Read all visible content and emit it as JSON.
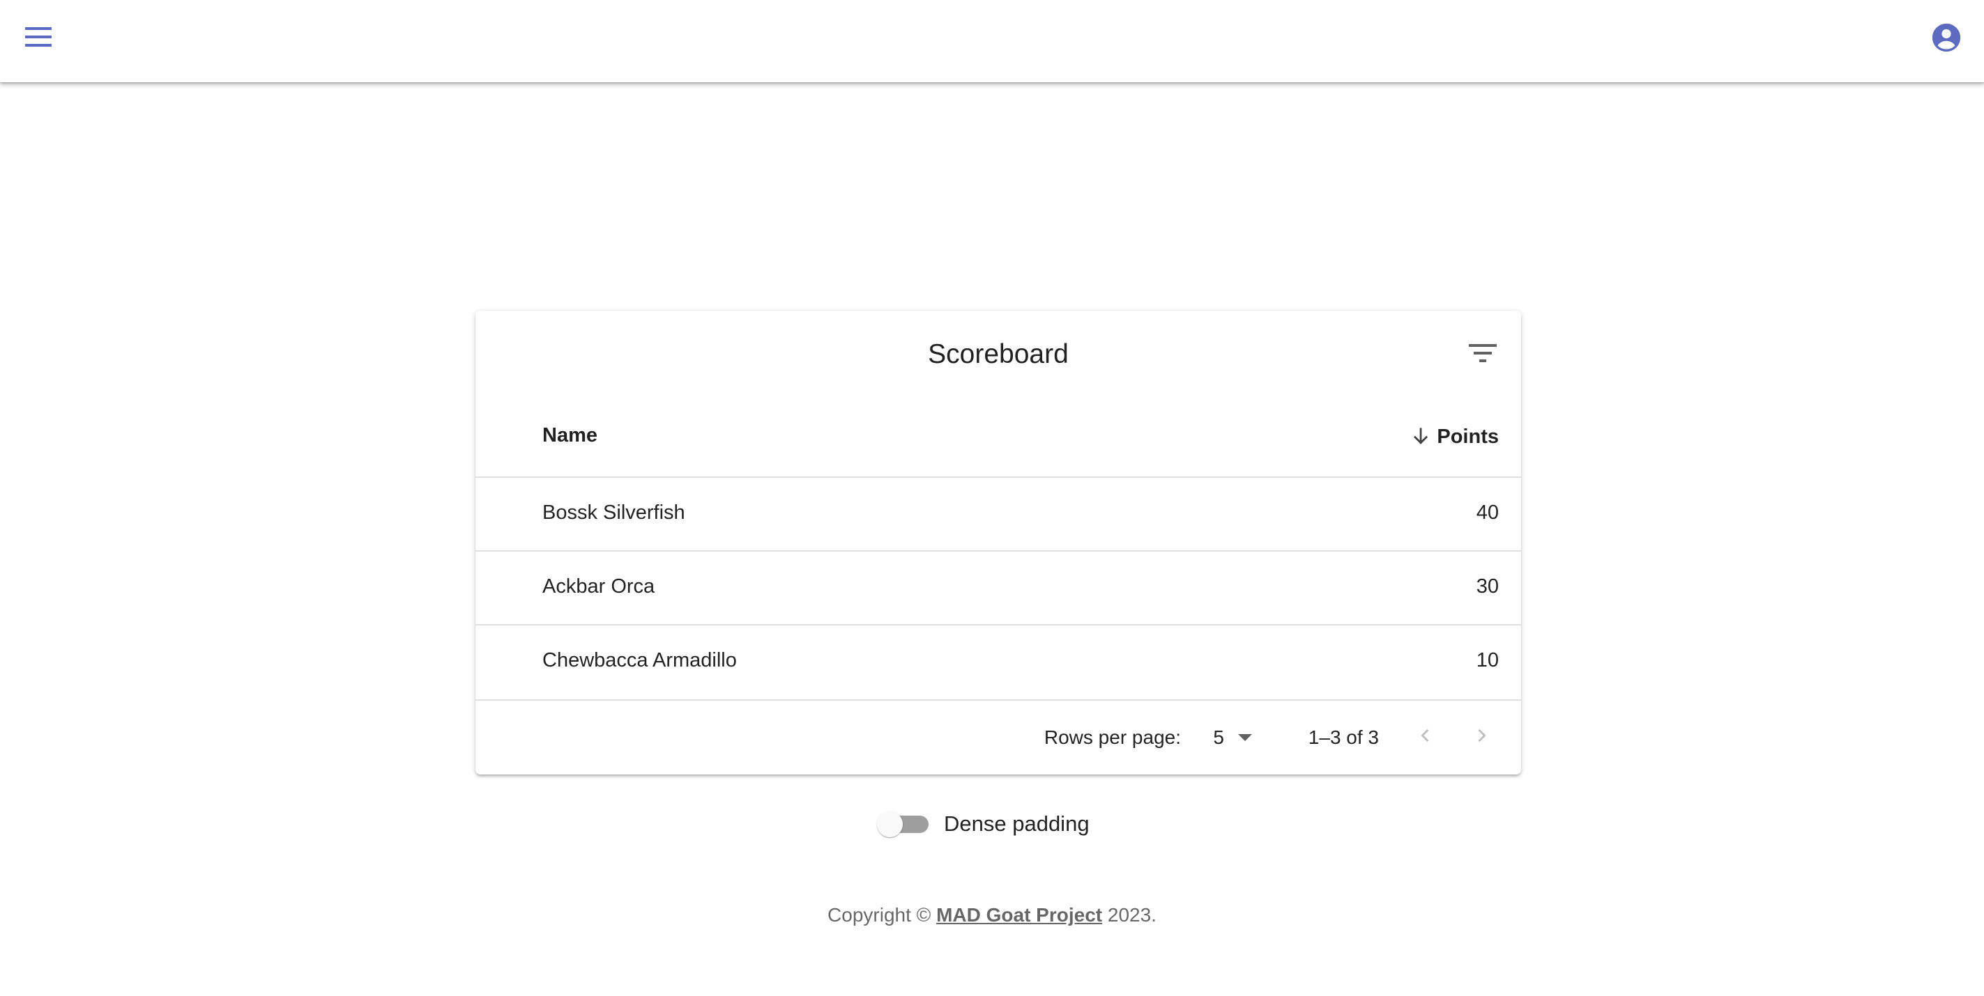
{
  "appbar": {
    "menu_icon": "hamburger-menu-icon",
    "account_icon": "account-circle-icon",
    "accent_color": "#5c6bc0"
  },
  "scoreboard": {
    "title": "Scoreboard",
    "filter_icon": "filter-list-icon",
    "columns": {
      "name": "Name",
      "points": "Points",
      "sort_icon": "arrow-downward-icon"
    },
    "rows": [
      {
        "name": "Bossk Silverfish",
        "points": "40"
      },
      {
        "name": "Ackbar Orca",
        "points": "30"
      },
      {
        "name": "Chewbacca Armadillo",
        "points": "10"
      }
    ],
    "pagination": {
      "rows_per_page_label": "Rows per page:",
      "rows_per_page_value": "5",
      "range_label": "1–3 of 3",
      "prev_icon": "chevron-left-icon",
      "next_icon": "chevron-right-icon"
    }
  },
  "dense_padding": {
    "label": "Dense padding",
    "checked": false
  },
  "footer": {
    "prefix": "Copyright ©",
    "link_text": "MAD Goat Project",
    "suffix": "2023."
  }
}
